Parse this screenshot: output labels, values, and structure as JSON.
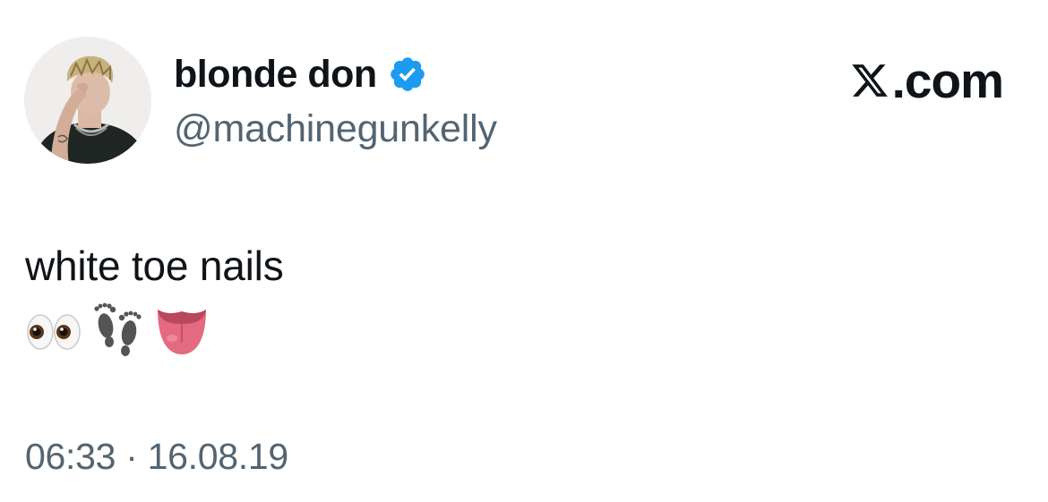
{
  "author": {
    "display_name": "blonde don",
    "handle": "@machinegunkelly",
    "verified": true,
    "verified_color": "#1d9bf0",
    "avatar_icon": "profile-photo"
  },
  "site": {
    "label": ".com",
    "logo_icon": "x-logo-icon"
  },
  "tweet": {
    "text": "white toe nails",
    "emojis": [
      "eyes-emoji",
      "footprints-emoji",
      "tongue-emoji"
    ]
  },
  "meta": {
    "timestamp": "06:33 · 16.08.19"
  },
  "colors": {
    "text_primary": "#0f1419",
    "text_secondary": "#536471",
    "background": "#ffffff"
  }
}
